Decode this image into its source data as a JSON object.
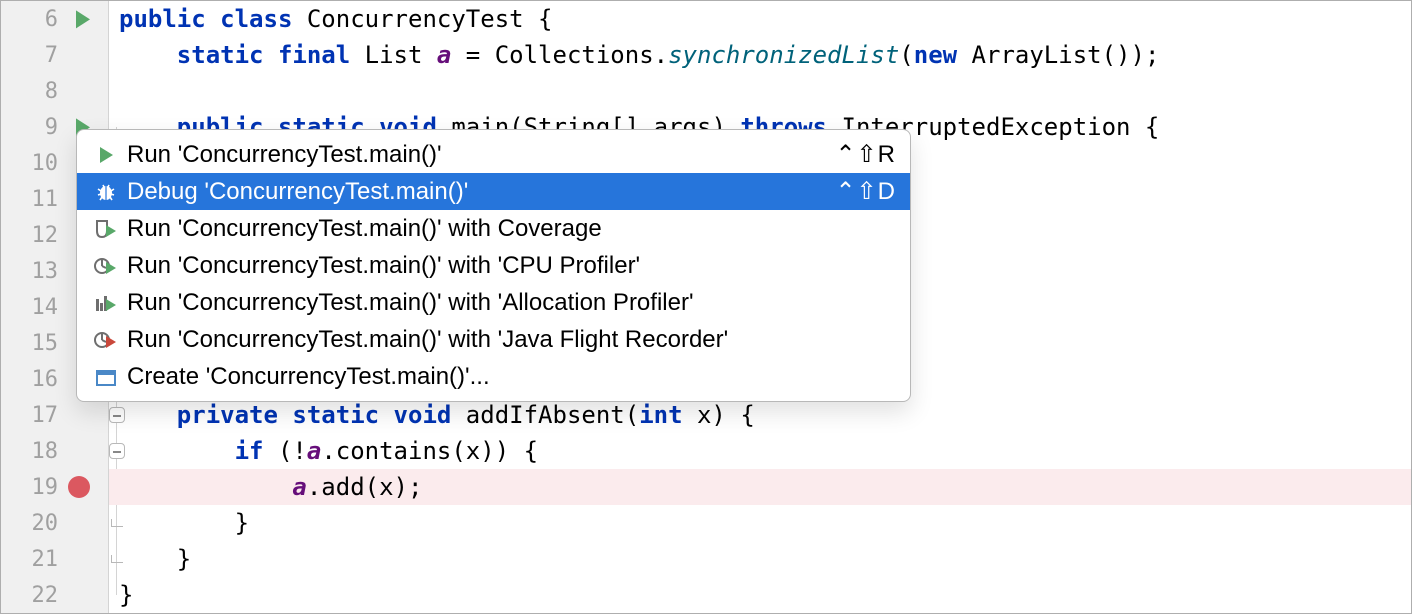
{
  "gutter": {
    "lines": [
      "6",
      "7",
      "8",
      "9",
      "10",
      "11",
      "12",
      "13",
      "14",
      "15",
      "16",
      "17",
      "18",
      "19",
      "20",
      "21",
      "22"
    ],
    "run_markers": [
      6,
      9
    ],
    "breakpoints": [
      19
    ]
  },
  "code": {
    "6": [
      [
        "kw",
        "public "
      ],
      [
        "kw",
        "class "
      ],
      [
        "black",
        "ConcurrencyTest {"
      ]
    ],
    "7": [
      [
        "black",
        "    "
      ],
      [
        "kw",
        "static "
      ],
      [
        "kw",
        "final "
      ],
      [
        "black",
        "List "
      ],
      [
        "field-italic",
        "a"
      ],
      [
        "black",
        " = Collections."
      ],
      [
        "static-meth",
        "synchronizedList"
      ],
      [
        "black",
        "("
      ],
      [
        "kw",
        "new "
      ],
      [
        "black",
        "ArrayList());"
      ]
    ],
    "8": [
      [
        "black",
        ""
      ]
    ],
    "9": [
      [
        "black",
        "    "
      ],
      [
        "kw",
        "public "
      ],
      [
        "kw",
        "static "
      ],
      [
        "kw",
        "void "
      ],
      [
        "black",
        "main(String[] args) "
      ],
      [
        "kw",
        "throws "
      ],
      [
        "black",
        "InterruptedException {"
      ]
    ],
    "10": [
      [
        "black",
        ""
      ]
    ],
    "11": [
      [
        "black",
        ""
      ]
    ],
    "12": [
      [
        "black",
        ""
      ]
    ],
    "13": [
      [
        "black",
        ""
      ]
    ],
    "14": [
      [
        "black",
        ""
      ]
    ],
    "15": [
      [
        "black",
        ""
      ]
    ],
    "16": [
      [
        "black",
        ""
      ]
    ],
    "17": [
      [
        "black",
        "    "
      ],
      [
        "kw",
        "private "
      ],
      [
        "kw",
        "static "
      ],
      [
        "kw",
        "void "
      ],
      [
        "black",
        "addIfAbsent("
      ],
      [
        "kw",
        "int "
      ],
      [
        "black",
        "x) {"
      ]
    ],
    "18": [
      [
        "black",
        "        "
      ],
      [
        "kw",
        "if "
      ],
      [
        "black",
        "(!"
      ],
      [
        "field-italic",
        "a"
      ],
      [
        "black",
        ".contains(x)) {"
      ]
    ],
    "19": [
      [
        "black",
        "            "
      ],
      [
        "field-italic",
        "a"
      ],
      [
        "black",
        ".add(x);"
      ]
    ],
    "20": [
      [
        "black",
        "        }"
      ]
    ],
    "21": [
      [
        "black",
        "    }"
      ]
    ],
    "22": [
      [
        "black",
        "}"
      ]
    ]
  },
  "context_menu": {
    "items": [
      {
        "icon": "play",
        "label": "Run 'ConcurrencyTest.main()'",
        "shortcut": "⌃⇧R",
        "selected": false
      },
      {
        "icon": "bug",
        "label": "Debug 'ConcurrencyTest.main()'",
        "shortcut": "⌃⇧D",
        "selected": true
      },
      {
        "icon": "coverage",
        "label": "Run 'ConcurrencyTest.main()' with Coverage",
        "shortcut": "",
        "selected": false
      },
      {
        "icon": "profiler",
        "label": "Run 'ConcurrencyTest.main()' with 'CPU Profiler'",
        "shortcut": "",
        "selected": false
      },
      {
        "icon": "alloc",
        "label": "Run 'ConcurrencyTest.main()' with 'Allocation Profiler'",
        "shortcut": "",
        "selected": false
      },
      {
        "icon": "jfr",
        "label": "Run 'ConcurrencyTest.main()' with 'Java Flight Recorder'",
        "shortcut": "",
        "selected": false
      },
      {
        "icon": "create",
        "label": "Create 'ConcurrencyTest.main()'...",
        "shortcut": "",
        "selected": false
      }
    ]
  }
}
